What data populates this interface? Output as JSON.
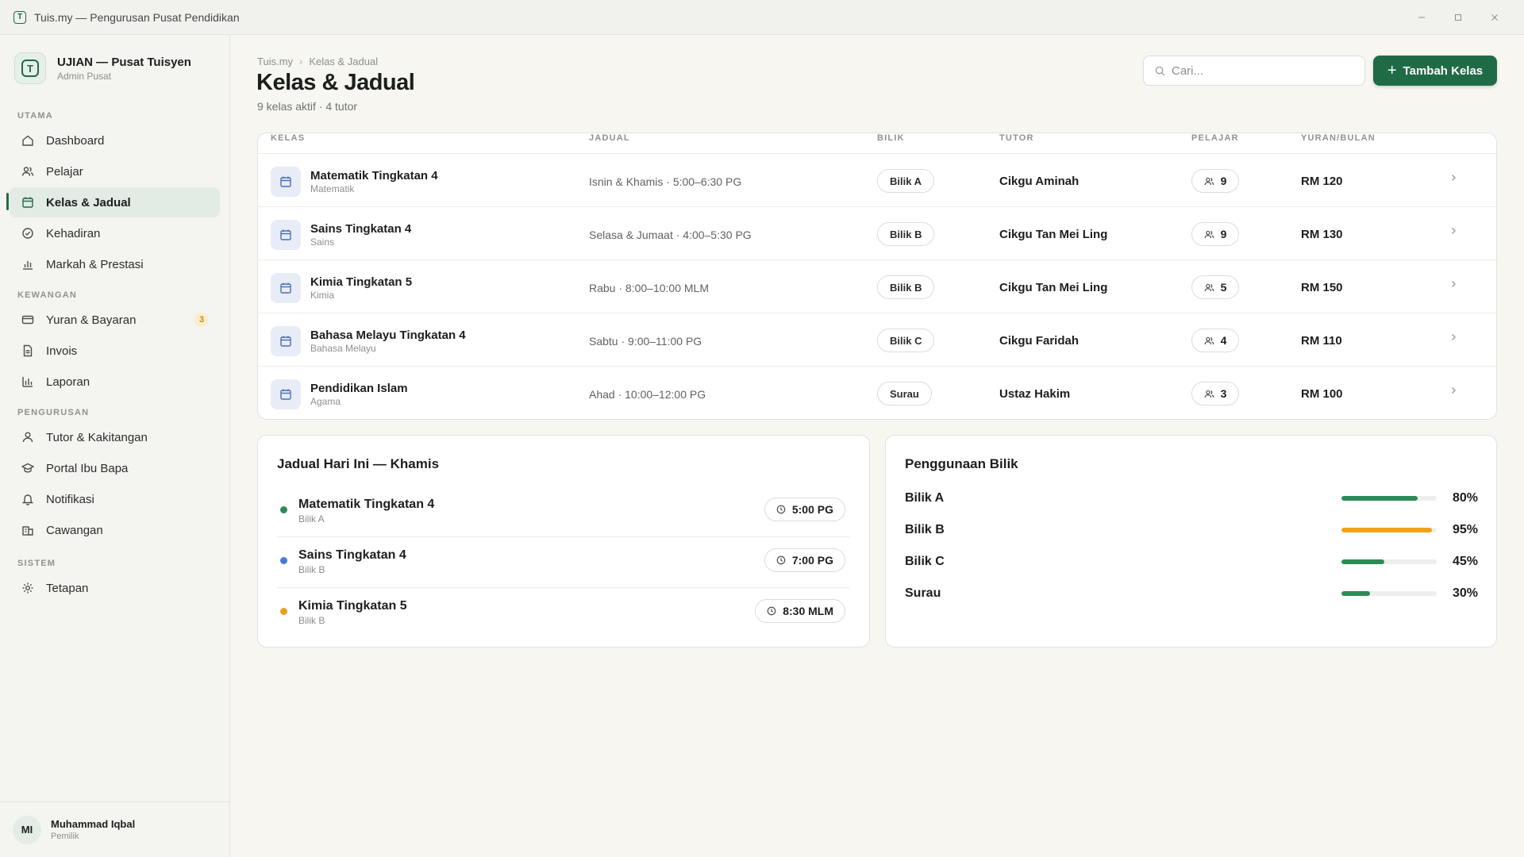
{
  "window": {
    "title": "Tuis.my — Pengurusan Pusat Pendidikan",
    "logo_letter": "T"
  },
  "brand": {
    "name": "UJIAN — Pusat Tuisyen",
    "role": "Admin Pusat",
    "logo_letter": "T"
  },
  "sidebar": {
    "sections": [
      {
        "label": "UTAMA"
      },
      {
        "label": "KEWANGAN"
      },
      {
        "label": "PENGURUSAN"
      },
      {
        "label": "SISTEM"
      }
    ],
    "items": [
      {
        "label": "Dashboard",
        "icon": "home-icon"
      },
      {
        "label": "Pelajar",
        "icon": "users-icon"
      },
      {
        "label": "Kelas & Jadual",
        "icon": "calendar-icon",
        "active": true
      },
      {
        "label": "Kehadiran",
        "icon": "check-circle-icon"
      },
      {
        "label": "Markah & Prestasi",
        "icon": "bar-chart-icon"
      },
      {
        "label": "Yuran & Bayaran",
        "icon": "credit-card-icon",
        "badge": "3"
      },
      {
        "label": "Invois",
        "icon": "document-icon"
      },
      {
        "label": "Laporan",
        "icon": "bar-chart-icon"
      },
      {
        "label": "Tutor & Kakitangan",
        "icon": "user-icon"
      },
      {
        "label": "Portal Ibu Bapa",
        "icon": "graduation-cap-icon"
      },
      {
        "label": "Notifikasi",
        "icon": "bell-icon"
      },
      {
        "label": "Cawangan",
        "icon": "building-icon"
      },
      {
        "label": "Tetapan",
        "icon": "gear-icon"
      }
    ]
  },
  "user": {
    "initials": "MI",
    "name": "Muhammad Iqbal",
    "role": "Pemilik"
  },
  "header": {
    "breadcrumb": [
      "Tuis.my",
      "Kelas & Jadual"
    ],
    "title": "Kelas & Jadual",
    "subtitle": "9 kelas aktif · 4 tutor",
    "search_placeholder": "Cari...",
    "add_button": "Tambah Kelas"
  },
  "table": {
    "columns": [
      "KELAS",
      "JADUAL",
      "BILIK",
      "TUTOR",
      "PELAJAR",
      "YURAN/BULAN"
    ],
    "rows": [
      {
        "name": "Matematik Tingkatan 4",
        "subject": "Matematik",
        "schedule": "Isnin & Khamis · 5:00–6:30 PG",
        "room": "Bilik A",
        "tutor": "Cikgu Aminah",
        "students": "9",
        "fee": "RM 120"
      },
      {
        "name": "Sains Tingkatan 4",
        "subject": "Sains",
        "schedule": "Selasa & Jumaat · 4:00–5:30 PG",
        "room": "Bilik B",
        "tutor": "Cikgu Tan Mei Ling",
        "students": "9",
        "fee": "RM 130"
      },
      {
        "name": "Kimia Tingkatan 5",
        "subject": "Kimia",
        "schedule": "Rabu · 8:00–10:00 MLM",
        "room": "Bilik B",
        "tutor": "Cikgu Tan Mei Ling",
        "students": "5",
        "fee": "RM 150"
      },
      {
        "name": "Bahasa Melayu Tingkatan 4",
        "subject": "Bahasa Melayu",
        "schedule": "Sabtu · 9:00–11:00 PG",
        "room": "Bilik C",
        "tutor": "Cikgu Faridah",
        "students": "4",
        "fee": "RM 110"
      },
      {
        "name": "Pendidikan Islam",
        "subject": "Agama",
        "schedule": "Ahad · 10:00–12:00 PG",
        "room": "Surau",
        "tutor": "Ustaz Hakim",
        "students": "3",
        "fee": "RM 100"
      }
    ]
  },
  "today": {
    "title": "Jadual Hari Ini — Khamis",
    "items": [
      {
        "name": "Matematik Tingkatan 4",
        "room": "Bilik A",
        "time": "5:00 PG",
        "color": "#2e8b57"
      },
      {
        "name": "Sains Tingkatan 4",
        "room": "Bilik B",
        "time": "7:00 PG",
        "color": "#4a78d8"
      },
      {
        "name": "Kimia Tingkatan 5",
        "room": "Bilik B",
        "time": "8:30 MLM",
        "color": "#e5a022"
      }
    ]
  },
  "usage": {
    "title": "Penggunaan Bilik",
    "rooms": [
      {
        "name": "Bilik A",
        "percent_label": "80%",
        "value": 0.8,
        "color": "#2e8b57"
      },
      {
        "name": "Bilik B",
        "percent_label": "95%",
        "value": 0.95,
        "color": "#f0a21b"
      },
      {
        "name": "Bilik C",
        "percent_label": "45%",
        "value": 0.45,
        "color": "#2e8b57"
      },
      {
        "name": "Surau",
        "percent_label": "30%",
        "value": 0.3,
        "color": "#2e8b57"
      }
    ]
  },
  "colors": {
    "accent": "#1f6b45",
    "warning": "#f0a21b",
    "info": "#4a78d8"
  }
}
